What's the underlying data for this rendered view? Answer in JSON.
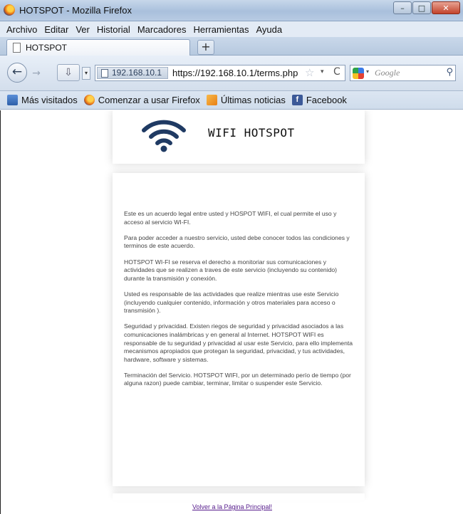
{
  "window": {
    "title": "HOTSPOT - Mozilla Firefox",
    "controls": {
      "minimize": "–",
      "maximize": "□",
      "close": "✕"
    }
  },
  "menubar": [
    "Archivo",
    "Editar",
    "Ver",
    "Historial",
    "Marcadores",
    "Herramientas",
    "Ayuda"
  ],
  "tab": {
    "label": "HOTSPOT",
    "new_tab": "+"
  },
  "nav": {
    "back": "←",
    "forward": "→",
    "download_icon": "⇩",
    "site_identity": "192.168.10.1",
    "url": "https://192.168.10.1/terms.php",
    "bookmark_star": "☆",
    "dropdown": "▾",
    "reload": "C",
    "search_placeholder": "Google",
    "search_go": "⚲"
  },
  "bookmarks": [
    {
      "label": "Más visitados",
      "icon": "most-visited-icon",
      "glyph": ""
    },
    {
      "label": "Comenzar a usar Firefox",
      "icon": "firefox-icon",
      "glyph": ""
    },
    {
      "label": "Últimas noticias",
      "icon": "rss-icon",
      "glyph": ""
    },
    {
      "label": "Facebook",
      "icon": "facebook-icon",
      "glyph": "f"
    }
  ],
  "page": {
    "header_title": "WIFI HOTSPOT",
    "terms": [
      "Este es un acuerdo legal entre usted y HOSPOT WIFI, el cual permite el uso y acceso al servicio WI-FI.",
      "Para poder acceder a nuestro servicio, usted debe conocer todos las condiciones y terminos de este acuerdo.",
      "HOTSPOT WI-FI se reserva el derecho a monitoriar sus comunicaciones y actividades que se realizen a traves de este servicio (incluyendo su contenido) durante la transmisión y conexión.",
      "Usted es responsable de las actividades que realize mientras use este Servicio (incluyendo cualquier contenido, información y otros materiales para acceso o transmisión ).",
      "Seguridad y privacidad. Existen riegos de seguridad y privacidad asociados a las comunicaciones inalámbricas y en general al Internet. HOTSPOT WIFI es responsable de tu seguridad y privacidad al usar este Servicio, para ello implementa mecanismos apropiados que protegan la seguridad, privacidad, y tus actividades, hardware, software y sistemas.",
      "Terminación del Servicio. HOTSPOT WIFI, por un determinado perío de tiempo (por alguna razon) puede cambiar, terminar, limitar o suspender este Servicio."
    ],
    "back_link": "Volver a la Página Principal!"
  },
  "colors": {
    "wifi_icon": "#1f3a63",
    "link_visited": "#551a8b"
  }
}
